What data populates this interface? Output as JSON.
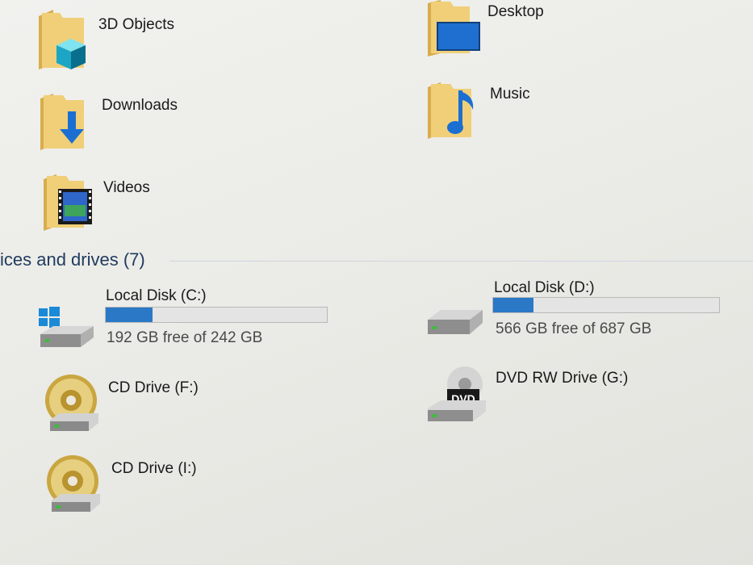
{
  "folders": [
    {
      "label": "3D Objects",
      "icon": "3d-objects-folder-icon"
    },
    {
      "label": "Desktop",
      "icon": "desktop-folder-icon"
    },
    {
      "label": "Downloads",
      "icon": "downloads-folder-icon"
    },
    {
      "label": "Music",
      "icon": "music-folder-icon"
    },
    {
      "label": "Videos",
      "icon": "videos-folder-icon"
    }
  ],
  "section": {
    "title": "ices and drives (7)"
  },
  "drives": [
    {
      "label": "Local Disk (C:)",
      "free": "192 GB free of 242 GB",
      "used_fraction": 0.21,
      "icon": "windows-drive-icon"
    },
    {
      "label": "Local Disk (D:)",
      "free": "566 GB free of 687 GB",
      "used_fraction": 0.18,
      "icon": "hard-drive-icon"
    },
    {
      "label": "CD Drive (F:)",
      "icon": "cd-drive-icon"
    },
    {
      "label": "DVD RW Drive (G:)",
      "icon": "dvd-drive-icon",
      "badge": "DVD"
    },
    {
      "label": "CD Drive (I:)",
      "icon": "cd-drive-icon"
    }
  ],
  "colors": {
    "folder": "#e8c36a",
    "accent": "#2a78c6",
    "bar_bg": "#e4e4e4"
  }
}
